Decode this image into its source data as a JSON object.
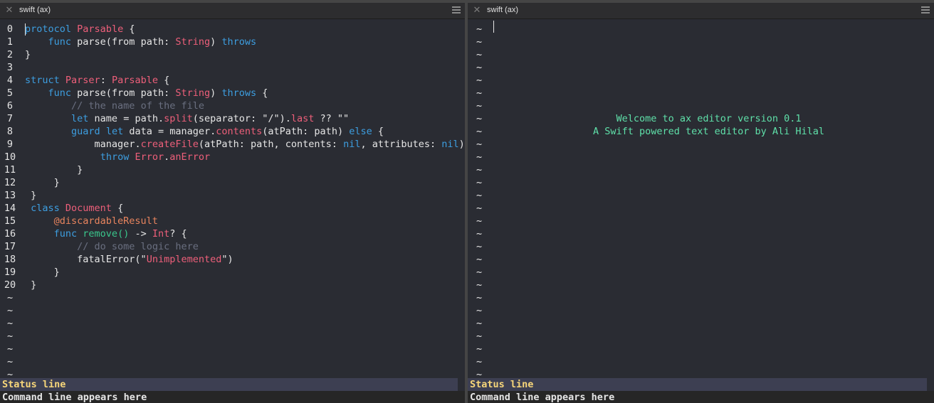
{
  "left_pane": {
    "title": "swift (ax)",
    "code": [
      {
        "n": "0",
        "indent": 0,
        "tokens": [
          [
            "kw",
            "protocol"
          ],
          [
            "",
            " "
          ],
          [
            "ty",
            "Parsable"
          ],
          [
            "",
            " {"
          ]
        ]
      },
      {
        "n": "1",
        "indent": 4,
        "tokens": [
          [
            "kw",
            "func"
          ],
          [
            "",
            " parse(from path: "
          ],
          [
            "ty",
            "String"
          ],
          [
            "",
            ") "
          ],
          [
            "kw",
            "throws"
          ]
        ]
      },
      {
        "n": "2",
        "indent": 0,
        "tokens": [
          [
            "",
            "}"
          ]
        ]
      },
      {
        "n": "3",
        "indent": 0,
        "tokens": []
      },
      {
        "n": "4",
        "indent": 0,
        "tokens": [
          [
            "kw",
            "struct"
          ],
          [
            "",
            " "
          ],
          [
            "ty",
            "Parser"
          ],
          [
            "",
            ": "
          ],
          [
            "ty",
            "Parsable"
          ],
          [
            "",
            " {"
          ]
        ]
      },
      {
        "n": "5",
        "indent": 4,
        "tokens": [
          [
            "kw",
            "func"
          ],
          [
            "",
            " parse(from path: "
          ],
          [
            "ty",
            "String"
          ],
          [
            "",
            ") "
          ],
          [
            "kw",
            "throws"
          ],
          [
            "",
            " {"
          ]
        ]
      },
      {
        "n": "6",
        "indent": 8,
        "tokens": [
          [
            "cm",
            "// the name of the file"
          ]
        ]
      },
      {
        "n": "7",
        "indent": 8,
        "tokens": [
          [
            "kw",
            "let"
          ],
          [
            "",
            " name = path."
          ],
          [
            "ty",
            "split"
          ],
          [
            "",
            "(separator: \"/\")."
          ],
          [
            "ty",
            "last"
          ],
          [
            "",
            " ?? \"\""
          ]
        ]
      },
      {
        "n": "8",
        "indent": 8,
        "tokens": [
          [
            "kw",
            "guard"
          ],
          [
            "",
            " "
          ],
          [
            "kw",
            "let"
          ],
          [
            "",
            " data = manager."
          ],
          [
            "ty",
            "contents"
          ],
          [
            "",
            "(atPath: path) "
          ],
          [
            "kw",
            "else"
          ],
          [
            "",
            " {"
          ]
        ]
      },
      {
        "n": "9",
        "indent": 12,
        "tokens": [
          [
            "",
            "manager."
          ],
          [
            "ty",
            "createFile"
          ],
          [
            "",
            "(atPath: path, contents: "
          ],
          [
            "kw",
            "nil"
          ],
          [
            "",
            ", attributes: "
          ],
          [
            "kw",
            "nil"
          ],
          [
            "",
            ")"
          ]
        ]
      },
      {
        "n": "10",
        "indent": 13,
        "tokens": [
          [
            "kw",
            "throw"
          ],
          [
            "",
            " "
          ],
          [
            "ty",
            "Error"
          ],
          [
            "",
            "."
          ],
          [
            "ty",
            "anError"
          ]
        ]
      },
      {
        "n": "11",
        "indent": 9,
        "tokens": [
          [
            "",
            "}"
          ]
        ]
      },
      {
        "n": "12",
        "indent": 5,
        "tokens": [
          [
            "",
            "}"
          ]
        ]
      },
      {
        "n": "13",
        "indent": 1,
        "tokens": [
          [
            "",
            "}"
          ]
        ]
      },
      {
        "n": "14",
        "indent": 1,
        "tokens": [
          [
            "kw",
            "class"
          ],
          [
            "",
            " "
          ],
          [
            "ty",
            "Document"
          ],
          [
            "",
            " {"
          ]
        ]
      },
      {
        "n": "15",
        "indent": 5,
        "tokens": [
          [
            "at",
            "@discardableResult"
          ]
        ]
      },
      {
        "n": "16",
        "indent": 5,
        "tokens": [
          [
            "kw",
            "func"
          ],
          [
            "",
            " "
          ],
          [
            "fn",
            "remove()"
          ],
          [
            "",
            " -> "
          ],
          [
            "ty",
            "Int"
          ],
          [
            "",
            "? {"
          ]
        ]
      },
      {
        "n": "17",
        "indent": 9,
        "tokens": [
          [
            "cm",
            "// do some logic here"
          ]
        ]
      },
      {
        "n": "18",
        "indent": 9,
        "tokens": [
          [
            "",
            "fatalError(\""
          ],
          [
            "ty",
            "Unimplemented"
          ],
          [
            "",
            "\")"
          ]
        ]
      },
      {
        "n": "19",
        "indent": 5,
        "tokens": [
          [
            "",
            "}"
          ]
        ]
      },
      {
        "n": "20",
        "indent": 1,
        "tokens": [
          [
            "",
            "}"
          ]
        ]
      }
    ],
    "tilde": "~",
    "tilde_count": 7,
    "status": "Status line",
    "command": "Command line appears here"
  },
  "right_pane": {
    "title": "swift (ax)",
    "tilde": "~",
    "tilde_count": 28,
    "welcome_line1": "Welcome to ax editor version 0.1",
    "welcome_line2": "A Swift powered text editor by Ali Hilal",
    "status": "Status line",
    "command": "Command line appears here"
  },
  "icons": {
    "close": "close-icon",
    "menu": "hamburger-menu-icon"
  }
}
